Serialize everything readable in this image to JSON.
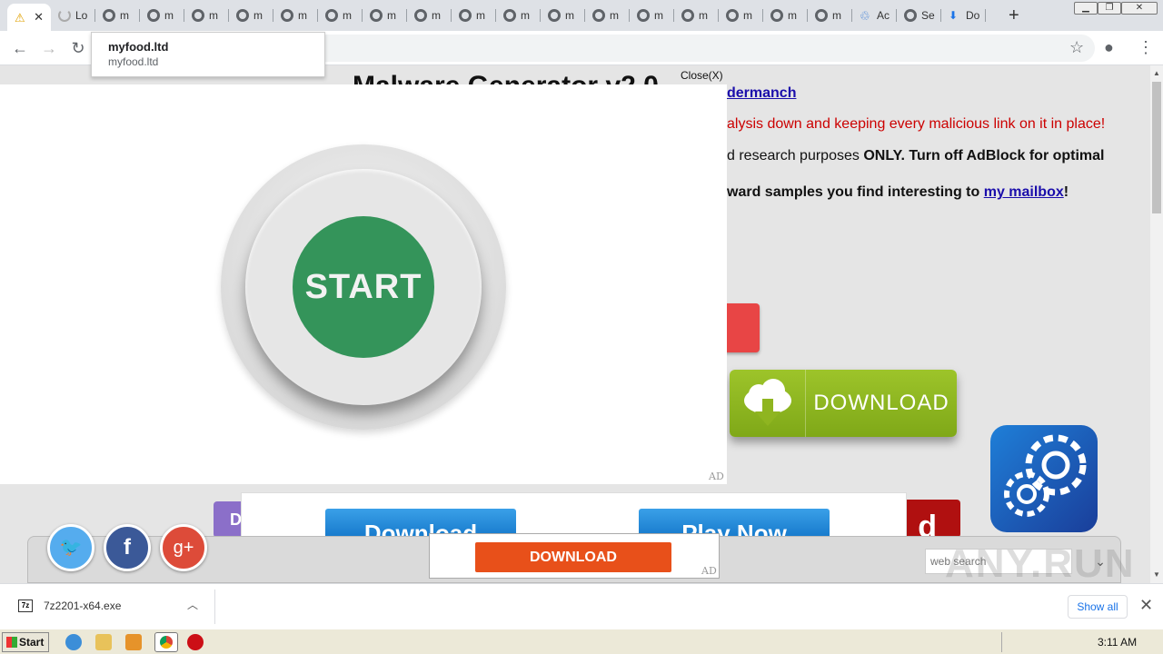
{
  "browser": {
    "tabs": [
      {
        "label": "",
        "icon": "warning-icon",
        "active": true
      },
      {
        "label": "Lo",
        "icon": "loading-icon"
      },
      {
        "label": "m",
        "icon": "globe-icon"
      },
      {
        "label": "m",
        "icon": "globe-icon"
      },
      {
        "label": "m",
        "icon": "globe-icon"
      },
      {
        "label": "m",
        "icon": "globe-icon"
      },
      {
        "label": "m",
        "icon": "globe-icon"
      },
      {
        "label": "m",
        "icon": "globe-icon"
      },
      {
        "label": "m",
        "icon": "globe-icon"
      },
      {
        "label": "m",
        "icon": "globe-icon"
      },
      {
        "label": "m",
        "icon": "globe-icon"
      },
      {
        "label": "m",
        "icon": "globe-icon"
      },
      {
        "label": "m",
        "icon": "globe-icon"
      },
      {
        "label": "m",
        "icon": "globe-icon"
      },
      {
        "label": "m",
        "icon": "globe-icon"
      },
      {
        "label": "m",
        "icon": "globe-icon"
      },
      {
        "label": "m",
        "icon": "globe-icon"
      },
      {
        "label": "m",
        "icon": "globe-icon"
      },
      {
        "label": "m",
        "icon": "globe-icon"
      },
      {
        "label": "Ac",
        "icon": "recycle-icon"
      },
      {
        "label": "Se",
        "icon": "globe-icon"
      },
      {
        "label": "Do",
        "icon": "download-icon"
      }
    ],
    "new_tab": "+",
    "suggestion": {
      "title": "myfood.ltd",
      "url": "myfood.ltd"
    }
  },
  "page": {
    "title": "Malware Generator v2.0",
    "author_link": "dermanch",
    "red_text": "alysis down and keeping every malicious link on it in place!",
    "line2_pre": "d research purposes ",
    "line2_only": "ONLY",
    "line2_post": ". Turn off AdBlock for optimal",
    "line3_pre": "ward samples you find interesting to ",
    "line3_link": "my mailbox",
    "line3_post": "!",
    "download_green": "DOWNLOAD",
    "ad2_btn1": "Download",
    "ad2_btn2": "Play Now",
    "purple_letter": "D",
    "darkred_text": "d",
    "download_orange": "DOWNLOAD",
    "ad_label": "AD",
    "web_search_placeholder": "web search",
    "social": {
      "twitter": "🐦",
      "facebook": "f",
      "google": "g+"
    }
  },
  "modal": {
    "close_label": "Close(X)",
    "start_label": "START",
    "ad_label": "AD"
  },
  "download_shelf": {
    "file_name": "7z2201-x64.exe",
    "file_icon_text": "7z",
    "show_all": "Show all"
  },
  "watermark": "ANY.RUN",
  "taskbar": {
    "start_label": "Start",
    "time": "3:11 AM"
  }
}
